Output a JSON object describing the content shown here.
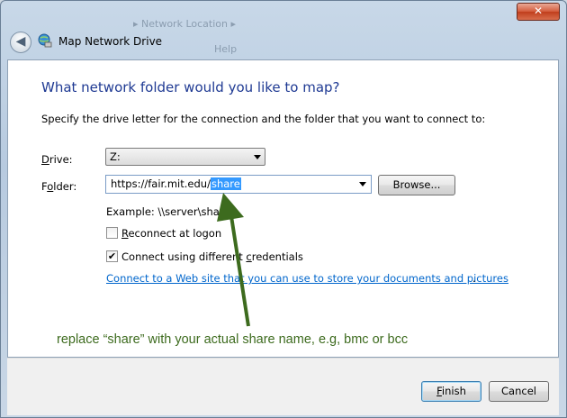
{
  "window": {
    "title": "Map Network Drive",
    "close_glyph": "✕",
    "back_glyph": "◀"
  },
  "main": {
    "heading": "What network folder would you like to map?",
    "intro": "Specify the drive letter for the connection and the folder that you want to connect to:",
    "drive": {
      "label_key": "D",
      "label_rest": "rive:",
      "value": "Z:"
    },
    "folder": {
      "label_key": "o",
      "label_pre": "F",
      "label_rest": "lder:",
      "value_prefix": "https://fair.mit.edu/",
      "value_selected": "share"
    },
    "browse_button": "Browse...",
    "example": "Example: \\\\server\\share",
    "reconnect": {
      "key": "R",
      "rest": "econnect at logon",
      "checked": false
    },
    "credentials": {
      "pre": "Connect using different ",
      "key": "c",
      "rest": "redentials",
      "checked": true
    },
    "link": "Connect to a Web site that you can use to store your documents and pictures",
    "link_suffix": "."
  },
  "annotation": {
    "text": "replace “share” with your actual share name, e.g, bmc or bcc",
    "color": "#3d6b1e"
  },
  "footer": {
    "finish_key": "F",
    "finish_rest": "inish",
    "cancel": "Cancel"
  },
  "background_text": {
    "line1": "▸ Network Location ▸",
    "line2": "Help"
  },
  "colors": {
    "heading": "#1f3a93",
    "link": "#0066cc",
    "selection": "#3399ff",
    "annotation": "#3d6b1e"
  }
}
